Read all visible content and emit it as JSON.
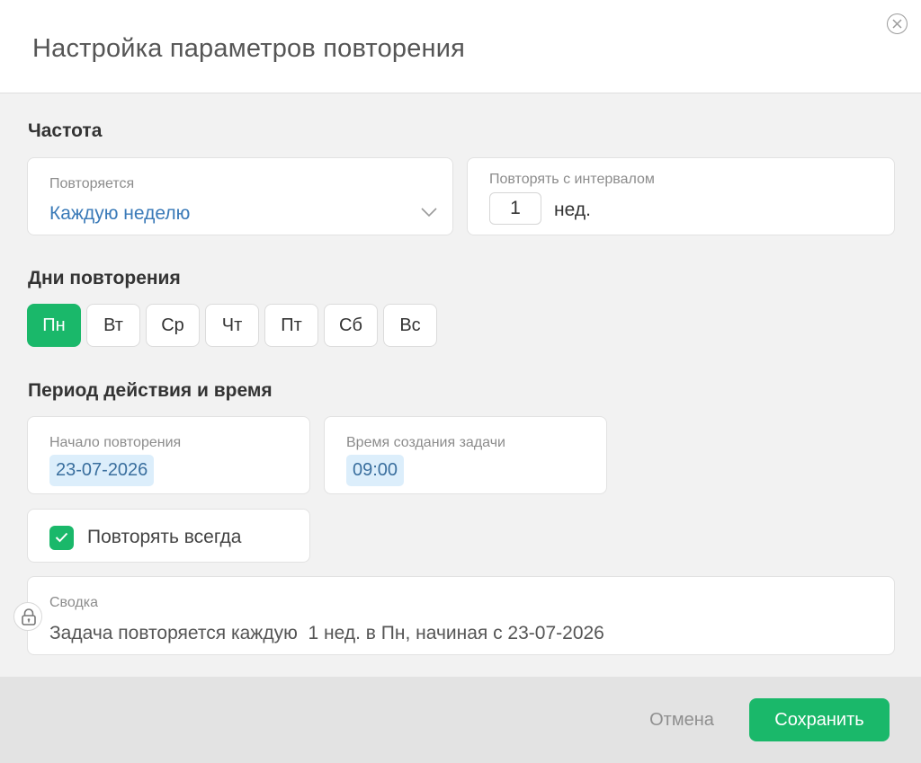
{
  "dialog": {
    "title": "Настройка параметров повторения"
  },
  "frequency": {
    "section_title": "Частота",
    "repeat": {
      "label": "Повторяется",
      "value": "Каждую неделю"
    },
    "interval": {
      "label": "Повторять с интервалом",
      "value": "1",
      "unit": "нед."
    }
  },
  "days": {
    "section_title": "Дни повторения",
    "items": [
      {
        "label": "Пн",
        "selected": true
      },
      {
        "label": "Вт",
        "selected": false
      },
      {
        "label": "Ср",
        "selected": false
      },
      {
        "label": "Чт",
        "selected": false
      },
      {
        "label": "Пт",
        "selected": false
      },
      {
        "label": "Сб",
        "selected": false
      },
      {
        "label": "Вс",
        "selected": false
      }
    ]
  },
  "period": {
    "section_title": "Период действия и время",
    "start": {
      "label": "Начало повторения",
      "value": "23-07-2026"
    },
    "time": {
      "label": "Время создания задачи",
      "value": "09:00"
    },
    "repeat_always": {
      "label": "Повторять всегда",
      "checked": true
    }
  },
  "summary": {
    "label": "Сводка",
    "text": "Задача повторяется каждую  1 нед. в Пн, начиная с 23-07-2026"
  },
  "footer": {
    "cancel_label": "Отмена",
    "save_label": "Сохранить"
  },
  "colors": {
    "accent": "#1ab86a",
    "link": "#3a7ab8",
    "chip_bg": "#dceefb"
  },
  "icons": {
    "close": "close-circle-icon",
    "dropdown": "chevron-down-icon",
    "check": "checkmark-icon",
    "lock": "lock-icon"
  }
}
